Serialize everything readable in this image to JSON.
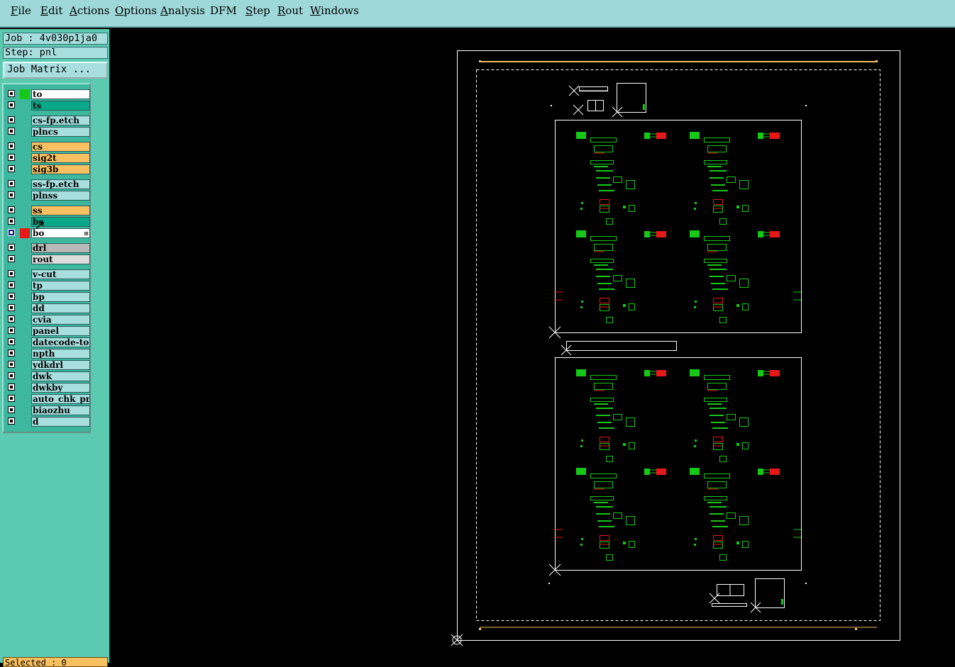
{
  "menubar": {
    "items": [
      {
        "label": "File",
        "m": "F",
        "r": "ile"
      },
      {
        "label": "Edit",
        "m": "E",
        "r": "dit"
      },
      {
        "label": "Actions",
        "m": "A",
        "r": "ctions"
      },
      {
        "label": "Options",
        "m": "O",
        "r": "ptions"
      },
      {
        "label": "Analysis",
        "m": "A",
        "r": "nalysis"
      },
      {
        "label": "DFM",
        "m": "",
        "r": "DFM"
      },
      {
        "label": "Step",
        "m": "S",
        "r": "tep"
      },
      {
        "label": "Rout",
        "m": "R",
        "r": "out"
      },
      {
        "label": "Windows",
        "m": "W",
        "r": "indows"
      }
    ]
  },
  "job": {
    "label": "Job : 4v030p1ja0"
  },
  "step": {
    "label": "Step: pnl"
  },
  "job_matrix_button": "Job Matrix ...",
  "layers": [
    {
      "name": "to",
      "bg": "#ffffff",
      "color": "#18c818",
      "state": "normal"
    },
    {
      "name": "ts",
      "bg": "#08a888",
      "color": "",
      "state": "normal"
    },
    {
      "name": "cs-fp.etch",
      "bg": "#a8dede",
      "color": "",
      "state": "normal"
    },
    {
      "name": "plncs",
      "bg": "#a8dede",
      "color": "",
      "state": "normal"
    },
    {
      "name": "cs",
      "bg": "#f8c060",
      "color": "",
      "state": "normal"
    },
    {
      "name": "sig2t",
      "bg": "#f8c060",
      "color": "",
      "state": "normal"
    },
    {
      "name": "sig3b",
      "bg": "#f8c060",
      "color": "",
      "state": "normal"
    },
    {
      "name": "ss-fp.etch",
      "bg": "#a8dede",
      "color": "",
      "state": "normal"
    },
    {
      "name": "plnss",
      "bg": "#a8dede",
      "color": "",
      "state": "normal"
    },
    {
      "name": "ss",
      "bg": "#f8c060",
      "color": "",
      "state": "normal"
    },
    {
      "name": "bs",
      "bg": "#08a888",
      "color": "",
      "state": "normal"
    },
    {
      "name": "bo",
      "bg": "#ffffff",
      "color": "#e81818",
      "state": "selected",
      "highlight": "⊞"
    },
    {
      "name": "drl",
      "bg": "#b8b8b8",
      "color": "",
      "state": "normal"
    },
    {
      "name": "rout",
      "bg": "#dcdcdc",
      "color": "",
      "state": "normal"
    },
    {
      "name": "v-cut",
      "bg": "#a8dede",
      "color": "",
      "state": "normal"
    },
    {
      "name": "tp",
      "bg": "#a8dede",
      "color": "",
      "state": "normal"
    },
    {
      "name": "bp",
      "bg": "#a8dede",
      "color": "",
      "state": "normal"
    },
    {
      "name": "dd",
      "bg": "#a8dede",
      "color": "",
      "state": "normal"
    },
    {
      "name": "cvia",
      "bg": "#a8dede",
      "color": "",
      "state": "normal"
    },
    {
      "name": "panel",
      "bg": "#a8dede",
      "color": "",
      "state": "normal"
    },
    {
      "name": "datecode-to",
      "bg": "#a8dede",
      "color": "",
      "state": "normal"
    },
    {
      "name": "npth",
      "bg": "#a8dede",
      "color": "",
      "state": "normal"
    },
    {
      "name": "ydkdrl",
      "bg": "#a8dede",
      "color": "",
      "state": "normal"
    },
    {
      "name": "dwk",
      "bg": "#a8dede",
      "color": "",
      "state": "normal"
    },
    {
      "name": "dwkby",
      "bg": "#a8dede",
      "color": "",
      "state": "normal"
    },
    {
      "name": "auto_chk_pnl",
      "bg": "#a8dede",
      "color": "",
      "state": "normal"
    },
    {
      "name": "biaozhu",
      "bg": "#a8dede",
      "color": "",
      "state": "normal"
    },
    {
      "name": "d",
      "bg": "#a8dede",
      "color": "",
      "state": "normal"
    }
  ],
  "status": {
    "selected": "Selected : 0"
  },
  "colors": {
    "menubar": "#9ed8d8",
    "panel": "#5cc9b1",
    "canvas": "#000000",
    "outline": "#ffffff",
    "copper": "#18c818",
    "pad": "#e81818",
    "strip": "#f8c060"
  }
}
